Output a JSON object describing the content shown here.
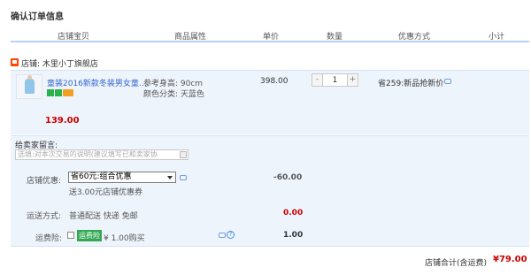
{
  "page_title": "确认订单信息",
  "columns": {
    "shop_item": "店铺宝贝",
    "attributes": "商品属性",
    "unit_price": "单价",
    "quantity": "数量",
    "promo": "优惠方式",
    "subtotal": "小计"
  },
  "shop": {
    "label": "店铺: 木里小丁旗舰店"
  },
  "item": {
    "title": "童装2016新款冬装男女童…",
    "prop_height": "参考身高: 90cm",
    "prop_color": "颜色分类: 天蓝色",
    "unit_price": "398.00",
    "quantity": "1",
    "qty_minus": "-",
    "qty_plus": "+",
    "promo": "省259:新品抢新价",
    "subtotal": "139.00"
  },
  "memo": {
    "label": "给卖家留言:",
    "placeholder": "选填:对本次交易的说明(建议填写已和卖家协"
  },
  "shop_discount": {
    "label": "店铺优惠:",
    "selected": "省60元:组合优惠",
    "note": "送3.00元店铺优惠券",
    "amount": "-60.00"
  },
  "shipping": {
    "label": "运送方式:",
    "text": "普通配送 快递 免邮",
    "amount": "0.00"
  },
  "insurance": {
    "label": "运费险:",
    "tag": "运费险",
    "text": "¥ 1.00购买",
    "help": "?",
    "amount": "1.00"
  },
  "total": {
    "label": "店铺合计(含运费)",
    "value": "¥79.00"
  },
  "colors": {
    "accent_blue": "#b2d1ff",
    "panel_bg": "#eef4fc",
    "price_red": "#cc0000",
    "link_blue": "#3366cc"
  }
}
